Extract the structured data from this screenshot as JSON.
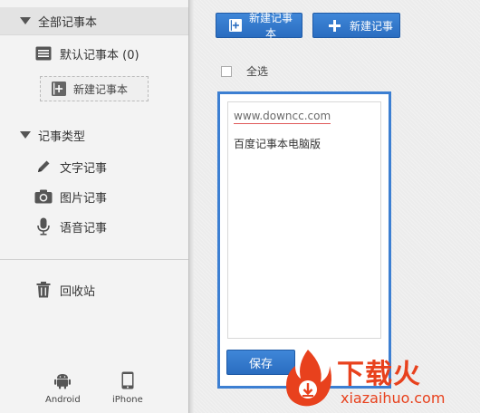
{
  "sidebar": {
    "all_notebooks": "全部记事本",
    "default_notebook": "默认记事本 (0)",
    "new_notebook": "新建记事本",
    "note_types": "记事类型",
    "types": [
      {
        "label": "文字记事",
        "icon": "pencil-icon"
      },
      {
        "label": "图片记事",
        "icon": "camera-icon"
      },
      {
        "label": "语音记事",
        "icon": "microphone-icon"
      }
    ],
    "recycle_bin": "回收站",
    "devices": [
      {
        "label": "Android",
        "icon": "android-icon"
      },
      {
        "label": "iPhone",
        "icon": "iphone-icon"
      }
    ]
  },
  "toolbar": {
    "new_notebook": "新建记事本",
    "new_note": "新建记事"
  },
  "list": {
    "select_all": "全选"
  },
  "editor": {
    "url": "www.downcc.com",
    "content": "百度记事本电脑版",
    "save": "保存"
  },
  "watermark": {
    "brand_cn": "下载火",
    "brand_en": "xiazaihuo.com"
  },
  "colors": {
    "accent": "#2f77cc",
    "watermark": "#e8411d"
  }
}
